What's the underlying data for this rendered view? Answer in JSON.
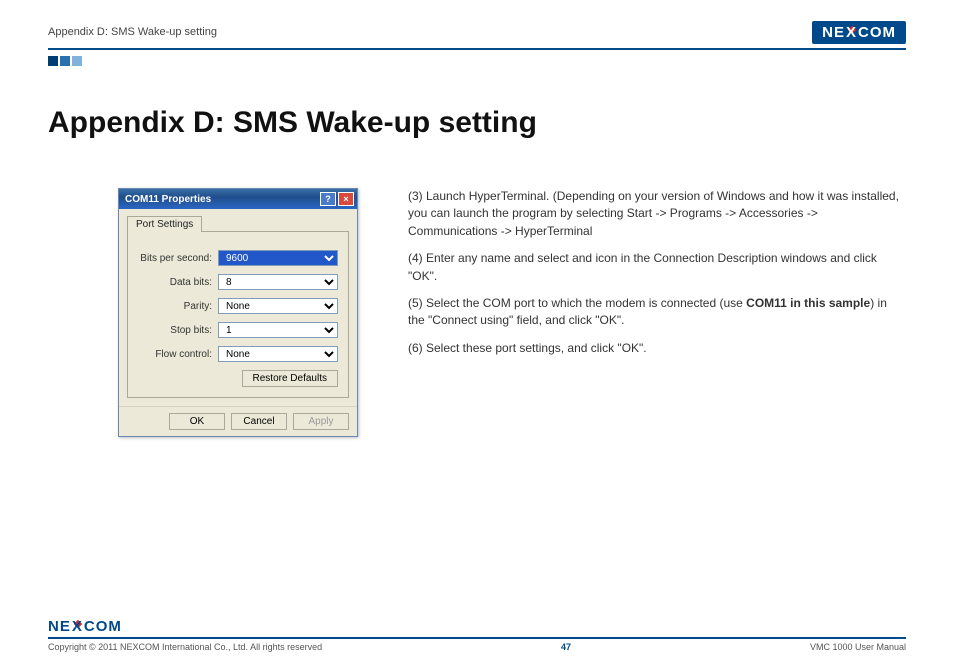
{
  "header": {
    "breadcrumb": "Appendix D: SMS Wake-up setting",
    "logo_text_left": "NE",
    "logo_text_x": "X",
    "logo_text_right": "COM"
  },
  "title": "Appendix D: SMS Wake-up setting",
  "dialog": {
    "title": "COM11 Properties",
    "help_glyph": "?",
    "close_glyph": "×",
    "tab_label": "Port Settings",
    "fields": {
      "bits_label": "Bits per second:",
      "bits_value": "9600",
      "data_label": "Data bits:",
      "data_value": "8",
      "parity_label": "Parity:",
      "parity_value": "None",
      "stop_label": "Stop bits:",
      "stop_value": "1",
      "flow_label": "Flow control:",
      "flow_value": "None"
    },
    "restore_label": "Restore Defaults",
    "ok_label": "OK",
    "cancel_label": "Cancel",
    "apply_label": "Apply"
  },
  "instructions": {
    "p3": "(3) Launch HyperTerminal. (Depending on your version of Windows and how it was installed, you can launch the program by selecting Start -> Programs -> Accessories -> Communications -> HyperTerminal",
    "p4": "(4) Enter any name and select and icon in the Connection Description windows and click \"OK\".",
    "p5a": "(5) Select the COM port to which the modem is connected (use ",
    "p5b": "COM11 in this sample",
    "p5c": ") in the \"Connect using\" field, and click \"OK\".",
    "p6": "(6) Select these port settings, and click \"OK\"."
  },
  "footer": {
    "logo_left": "NE",
    "logo_x": "X",
    "logo_right": "COM",
    "copyright": "Copyright © 2011 NEXCOM International Co., Ltd. All rights reserved",
    "page": "47",
    "manual": "VMC 1000 User Manual"
  }
}
